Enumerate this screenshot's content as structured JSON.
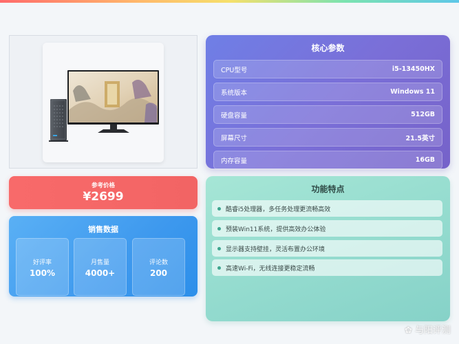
{
  "specs": {
    "title": "核心参数",
    "rows": [
      {
        "label": "CPU型号",
        "value": "i5-13450HX"
      },
      {
        "label": "系统版本",
        "value": "Windows 11"
      },
      {
        "label": "硬盘容量",
        "value": "512GB"
      },
      {
        "label": "屏幕尺寸",
        "value": "21.5英寸"
      },
      {
        "label": "内存容量",
        "value": "16GB"
      }
    ]
  },
  "price": {
    "label": "参考价格",
    "value": "¥2699"
  },
  "sales": {
    "title": "销售数据",
    "stats": [
      {
        "label": "好评率",
        "value": "100%"
      },
      {
        "label": "月售量",
        "value": "4000+"
      },
      {
        "label": "评论数",
        "value": "200"
      }
    ]
  },
  "features": {
    "title": "功能特点",
    "items": [
      "酷睿i5处理器，多任务处理更流畅高效",
      "预装Win11系统，提供高效办公体验",
      "显示器支持壁挂，灵活布置办公环境",
      "高速Wi-Fi，无线连接更稳定流畅"
    ]
  },
  "watermark": "与阳评测",
  "colors": {
    "specs_bg": "#7a6fd8",
    "price_bg": "#f46666",
    "sales_bg": "#3e99ee",
    "features_bg": "#95dccf"
  }
}
